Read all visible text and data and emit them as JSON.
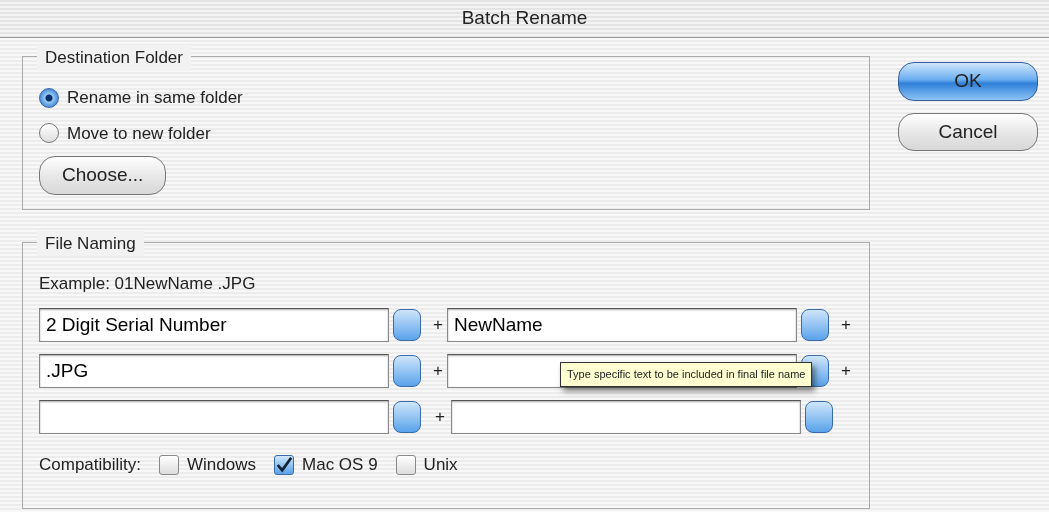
{
  "window": {
    "title": "Batch Rename"
  },
  "destination": {
    "legend": "Destination Folder",
    "options": [
      {
        "label": "Rename in same folder",
        "selected": true
      },
      {
        "label": "Move to new folder",
        "selected": false
      }
    ],
    "choose_button": "Choose..."
  },
  "buttons": [
    {
      "label": "OK",
      "default": true
    },
    {
      "label": "Cancel",
      "default": false
    }
  ],
  "file_naming": {
    "legend": "File Naming",
    "example": "Example: 01NewName .JPG",
    "rows": [
      {
        "left": "2 Digit Serial Number",
        "joiner": "+",
        "right": "NewName",
        "trailing": "+"
      },
      {
        "left": ".JPG",
        "joiner": "+",
        "right": "",
        "trailing": "+"
      },
      {
        "left": "",
        "joiner": "+",
        "right": ""
      }
    ],
    "tooltip": "Type specific text to be included in final file name",
    "compatibility": {
      "label": "Compatibility:",
      "options": [
        {
          "label": "Windows",
          "checked": false
        },
        {
          "label": "Mac OS 9",
          "checked": true
        },
        {
          "label": "Unix",
          "checked": false
        }
      ]
    }
  }
}
